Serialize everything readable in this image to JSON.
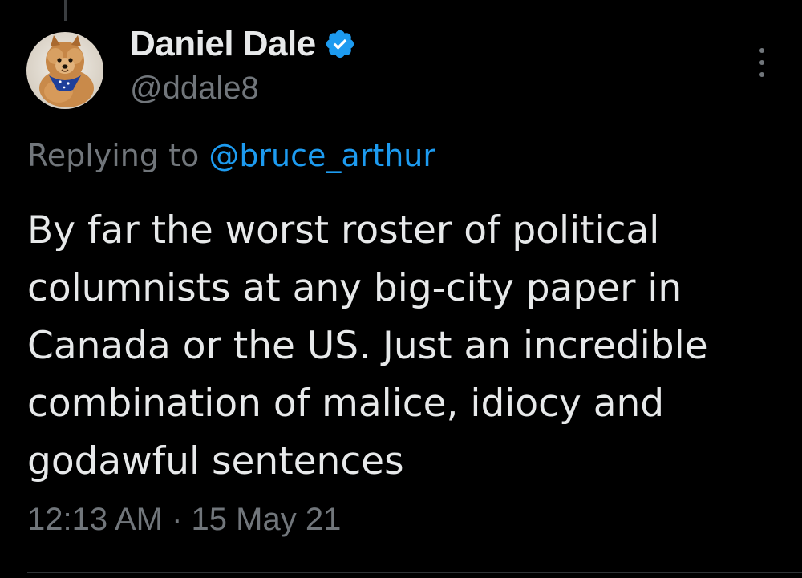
{
  "tweet": {
    "author": {
      "display_name": "Daniel Dale",
      "handle": "@ddale8",
      "verified_icon": "verified-badge-icon",
      "avatar_icon": "pomeranian-dog-avatar"
    },
    "reply_context": {
      "prefix": "Replying to ",
      "mention": "@bruce_arthur"
    },
    "text_lines": [
      "By far the worst roster of political",
      "columnists at any big-city paper in",
      "Canada or the US. Just an incredible",
      "combination of malice, idiocy and",
      "godawful sentences"
    ],
    "timestamp": "12:13 AM · 15 May 21",
    "more_icon": "vertical-ellipsis-icon"
  },
  "colors": {
    "background": "#000000",
    "text_primary": "#e7e9ea",
    "text_secondary": "#71767b",
    "accent_blue": "#1d9bf0",
    "divider": "#2f3336"
  }
}
